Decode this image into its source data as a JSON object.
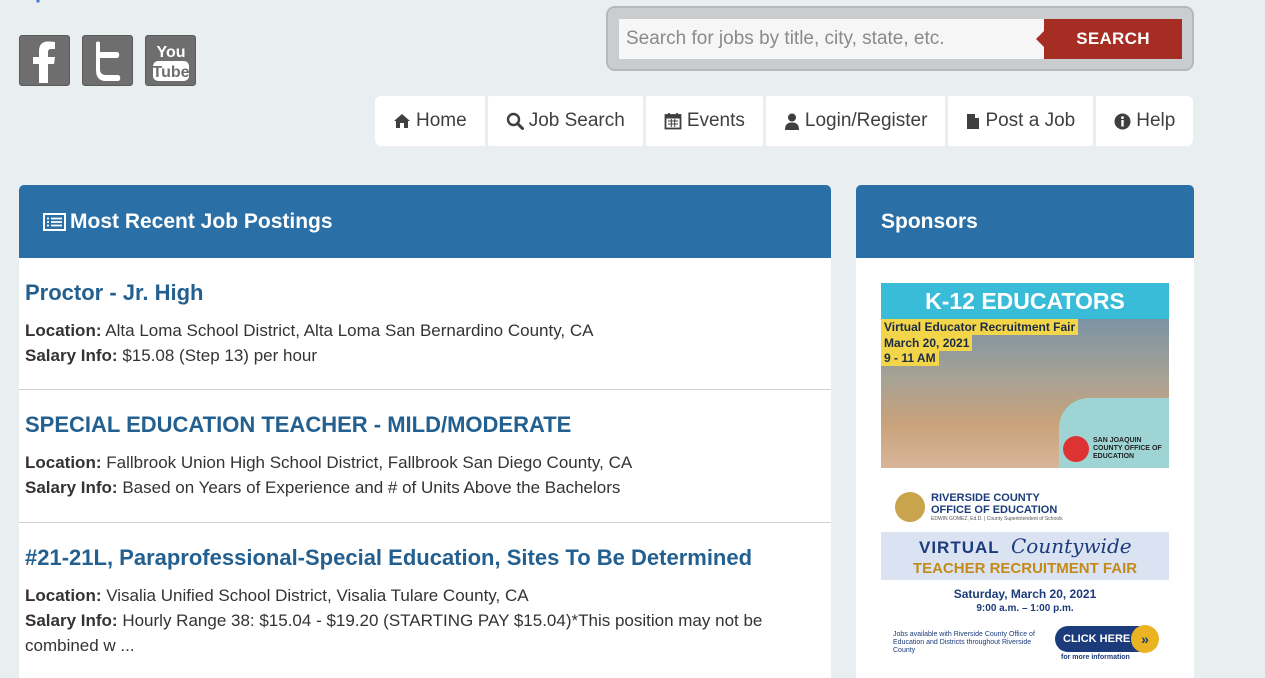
{
  "header": {
    "social": [
      {
        "name": "facebook-icon",
        "label": "Facebook"
      },
      {
        "name": "twitter-icon",
        "label": "Twitter"
      },
      {
        "name": "youtube-icon",
        "label": "YouTube"
      }
    ],
    "search": {
      "placeholder": "Search for jobs by title, city, state, etc.",
      "button_label": "SEARCH"
    }
  },
  "nav": {
    "items": [
      {
        "label": "Home",
        "icon": "home-icon"
      },
      {
        "label": "Job Search",
        "icon": "search-icon"
      },
      {
        "label": "Events",
        "icon": "calendar-icon"
      },
      {
        "label": "Login/Register",
        "icon": "user-icon"
      },
      {
        "label": "Post a Job",
        "icon": "file-icon"
      },
      {
        "label": "Help",
        "icon": "info-icon"
      }
    ]
  },
  "main": {
    "title": "Most Recent Job Postings",
    "location_label": "Location:",
    "salary_label": "Salary Info:",
    "jobs": [
      {
        "title": "Proctor - Jr. High",
        "location": "Alta Loma School District, Alta Loma San Bernardino County, CA",
        "salary": "$15.08 (Step 13) per hour"
      },
      {
        "title": "SPECIAL EDUCATION TEACHER - MILD/MODERATE",
        "location": "Fallbrook Union High School District, Fallbrook San Diego County, CA",
        "salary": "Based on Years of Experience and # of Units Above the Bachelors"
      },
      {
        "title": "#21-21L, Paraprofessional-Special Education, Sites To Be Determined",
        "location": "Visalia Unified School District, Visalia Tulare County, CA",
        "salary": "Hourly Range 38: $15.04 - $19.20 (STARTING PAY $15.04)*This position may not be combined w ..."
      }
    ]
  },
  "sidebar": {
    "title": "Sponsors",
    "ad1": {
      "headline": "K-12 EDUCATORS",
      "line1": "Virtual Educator Recruitment Fair",
      "line2": "March 20, 2021",
      "line3": "9 - 11 AM",
      "org": "SAN JOAQUIN COUNTY OFFICE OF EDUCATION"
    },
    "ad2": {
      "org_line1": "RIVERSIDE COUNTY",
      "org_line2": "OFFICE OF EDUCATION",
      "org_sub": "EDWIN GOMEZ, Ed.D. | County Superintendent of Schools",
      "virtual": "VIRTUAL",
      "countywide": "Countywide",
      "fair": "TEACHER RECRUITMENT FAIR",
      "date": "Saturday, March 20, 2021",
      "time": "9:00 a.m. – 1:00 p.m.",
      "jobs_note": "Jobs available with Riverside County Office of Education and Districts throughout Riverside County",
      "click_label": "CLICK HERE",
      "more": "for more information"
    }
  },
  "colors": {
    "page_bg": "#e9eef1",
    "panel_header": "#2a6fa5",
    "job_title": "#24608f",
    "search_button": "#a62d24"
  }
}
